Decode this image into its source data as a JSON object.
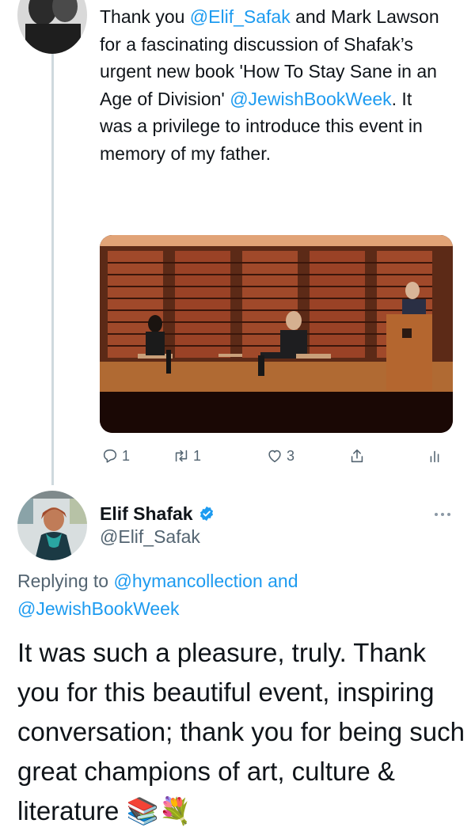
{
  "tweet1": {
    "text": {
      "t1": "Thank you ",
      "m1": "@Elif_Safak",
      "t2": " and Mark Lawson for a fascinating discussion of Shafak’s urgent new book 'How To Stay Sane in an Age of Division' ",
      "m2": "@JewishBookWeek",
      "t3": ". It was a privilege to introduce this event in memory of my father."
    },
    "actions": {
      "replies": "1",
      "retweets": "1",
      "likes": "3"
    },
    "icons": [
      "reply-icon",
      "retweet-icon",
      "like-icon",
      "share-icon",
      "analytics-icon"
    ]
  },
  "tweet2": {
    "display_name": "Elif Shafak",
    "handle": "@Elif_Safak",
    "verified_icon": "verified-badge-icon",
    "more_icon": "more-icon",
    "replying": {
      "prefix": "Replying to ",
      "m1": "@hymancollection",
      "and": " and",
      "m2": "@JewishBookWeek"
    },
    "text": "It was such a pleasure, truly. Thank you for this beautiful event, inspiring conversation; thank you for being such great champions of art, culture & literature 📚💐"
  },
  "colors": {
    "accent": "#1d9bf0",
    "secondary_text": "#536471",
    "text": "#0f1419"
  }
}
